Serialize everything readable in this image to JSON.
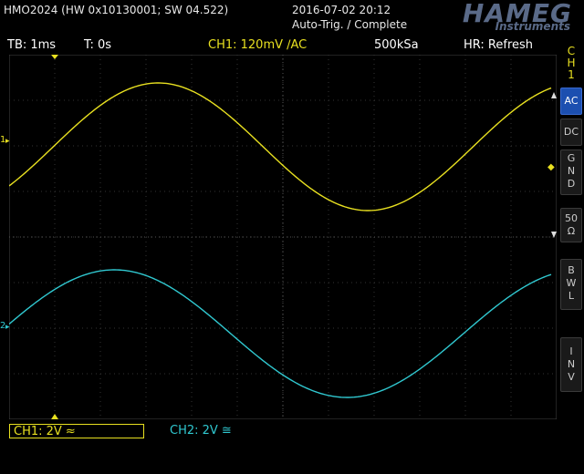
{
  "header": {
    "device_info": "HMO2024 (HW 0x10130001; SW 04.522)",
    "datetime": "2016-07-02 20:12",
    "trigger_status": "Auto-Trig. / Complete",
    "brand": "HAMEG",
    "brand_sub": "Instruments"
  },
  "status": {
    "timebase": "TB: 1ms",
    "trigger_time": "T: 0s",
    "ch1_setting": "CH1: 120mV ∕AC",
    "sample_rate": "500kSa",
    "hr_mode": "HR: Refresh"
  },
  "side_panel": {
    "channel_label": "C\nH\n1",
    "buttons": [
      {
        "label": "AC",
        "active": true
      },
      {
        "label": "DC",
        "active": false
      },
      {
        "label": "G\nN\nD",
        "active": false
      },
      {
        "label": "50\nΩ",
        "active": false
      },
      {
        "label": "B\nW\nL",
        "active": false
      },
      {
        "label": "I\nN\nV",
        "active": false
      }
    ]
  },
  "bottom": {
    "ch1_scale": "CH1: 2V ≈",
    "ch2_scale": "CH2: 2V ≅"
  },
  "markers": {
    "ch1_marker": "1",
    "ch2_marker": "2"
  },
  "colors": {
    "ch1": "#e8e020",
    "ch2": "#30c8d0",
    "grid": "#3a3a3a",
    "active_button": "#1c4fb0"
  },
  "waveforms": {
    "ch1": {
      "type": "sine"
    },
    "ch2": {
      "type": "sine"
    }
  }
}
